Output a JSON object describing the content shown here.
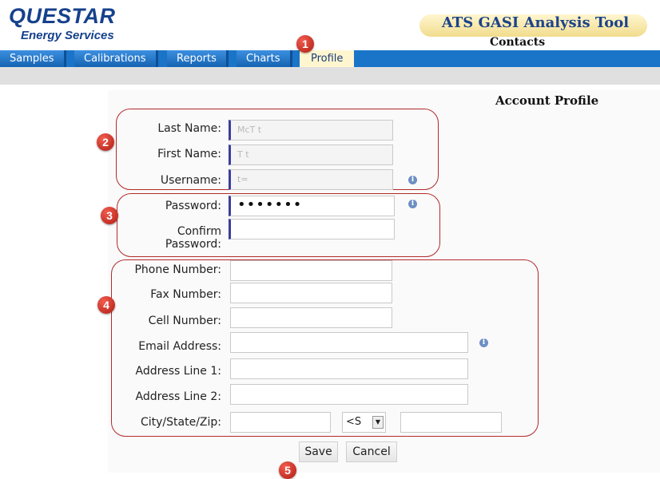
{
  "header": {
    "logo_main": "QUESTAR",
    "logo_sub": "Energy Services",
    "app_title": "ATS GASI Analysis Tool",
    "app_subtitle": "Contacts"
  },
  "nav": {
    "tabs": [
      {
        "label": "Samples"
      },
      {
        "label": "Calibrations"
      },
      {
        "label": "Reports"
      },
      {
        "label": "Charts"
      },
      {
        "label": "Profile",
        "active": true
      }
    ]
  },
  "form": {
    "section_title": "Account Profile",
    "fields": {
      "last_name": {
        "label": "Last Name:",
        "value": "McT t"
      },
      "first_name": {
        "label": "First Name:",
        "value": "T t"
      },
      "username": {
        "label": "Username:",
        "value": "t="
      },
      "password": {
        "label": "Password:",
        "value": "•••••••"
      },
      "confirm_password": {
        "label": "Confirm Password:",
        "value": ""
      },
      "phone": {
        "label": "Phone Number:",
        "value": ""
      },
      "fax": {
        "label": "Fax Number:",
        "value": ""
      },
      "cell": {
        "label": "Cell Number:",
        "value": ""
      },
      "email": {
        "label": "Email Address:",
        "value": ""
      },
      "address1": {
        "label": "Address Line 1:",
        "value": ""
      },
      "address2": {
        "label": "Address Line 2:",
        "value": ""
      },
      "city_state_zip": {
        "label": "City/State/Zip:",
        "city": "",
        "state": "<S",
        "zip": ""
      }
    },
    "buttons": {
      "save": "Save",
      "cancel": "Cancel"
    }
  },
  "annotations": {
    "badges": [
      "1",
      "2",
      "3",
      "4",
      "5"
    ],
    "colors": {
      "callout": "#b22a2a",
      "nav": "#1a74c7",
      "active_tab": "#fff6cf"
    }
  },
  "icons": [
    "info-icon",
    "dropdown-arrow-icon"
  ]
}
